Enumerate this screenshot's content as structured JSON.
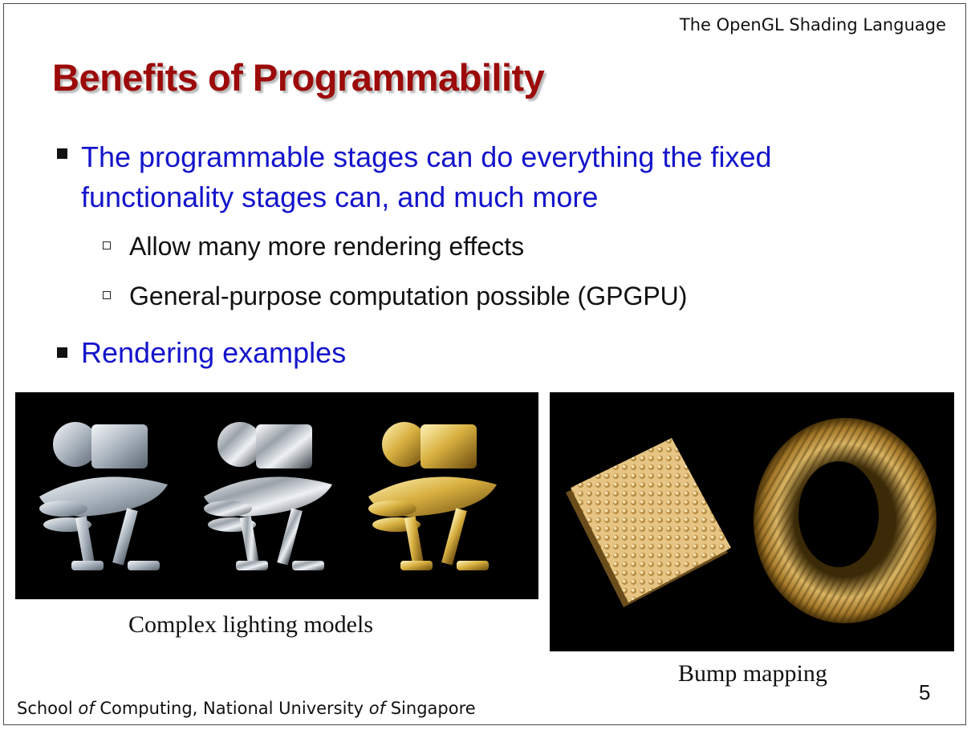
{
  "header": {
    "course_title": "The OpenGL Shading Language"
  },
  "slide": {
    "title": "Benefits of Programmability",
    "bullets": [
      {
        "text": "The programmable stages can do everything the fixed functionality stages can, and much more"
      },
      {
        "text": "Allow many more rendering effects"
      },
      {
        "text": "General-purpose computation possible (GPGPU)"
      },
      {
        "text": "Rendering examples"
      }
    ],
    "images": [
      {
        "caption": "Complex lighting models"
      },
      {
        "caption": "Bump mapping"
      }
    ],
    "page_number": "5"
  },
  "footer": {
    "part1": "School ",
    "of1": "of",
    "part2": " Computing, National University ",
    "of2": "of",
    "part3": " Singapore"
  },
  "colors": {
    "title": "#9c0a0a",
    "bullet_text": "#1414cc",
    "sub_text": "#111111",
    "image_background": "#000000",
    "gold": "#c9a24a",
    "silver": "#c8cdd3"
  }
}
